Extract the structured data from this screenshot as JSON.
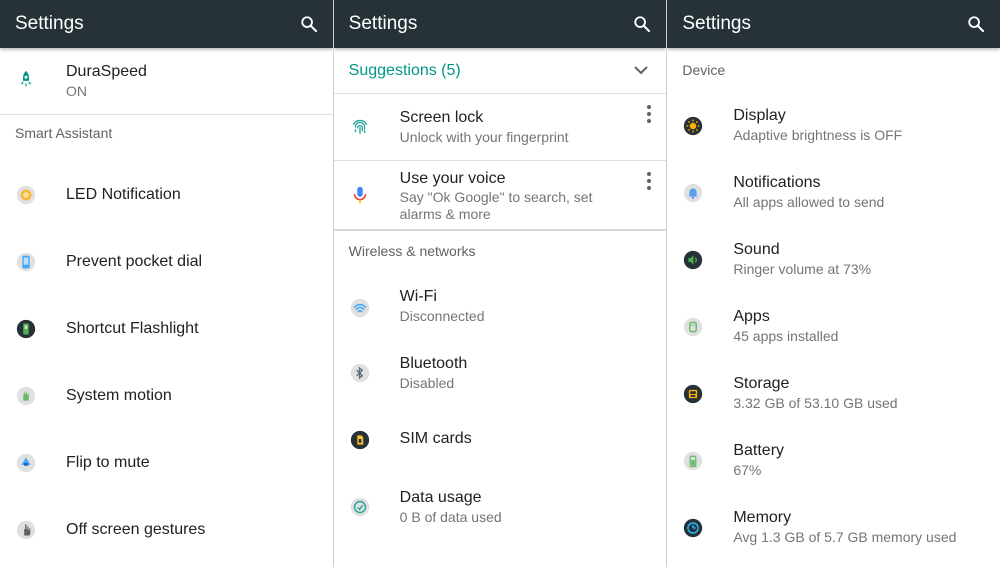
{
  "panels": [
    {
      "title": "Settings",
      "top": {
        "title": "DuraSpeed",
        "subtitle": "ON"
      },
      "section": "Smart Assistant",
      "items": [
        {
          "title": "LED Notification"
        },
        {
          "title": "Prevent pocket dial"
        },
        {
          "title": "Shortcut Flashlight"
        },
        {
          "title": "System motion"
        },
        {
          "title": "Flip to mute"
        },
        {
          "title": "Off screen gestures"
        }
      ]
    },
    {
      "title": "Settings",
      "suggestions_label": "Suggestions (5)",
      "suggestions": [
        {
          "title": "Screen lock",
          "subtitle": "Unlock with your fingerprint"
        },
        {
          "title": "Use your voice",
          "subtitle": "Say \"Ok Google\" to search, set alarms & more"
        }
      ],
      "section": "Wireless & networks",
      "items": [
        {
          "title": "Wi-Fi",
          "subtitle": "Disconnected"
        },
        {
          "title": "Bluetooth",
          "subtitle": "Disabled"
        },
        {
          "title": "SIM cards"
        },
        {
          "title": "Data usage",
          "subtitle": "0 B of data used"
        }
      ]
    },
    {
      "title": "Settings",
      "section": "Device",
      "items": [
        {
          "title": "Display",
          "subtitle": "Adaptive brightness is OFF"
        },
        {
          "title": "Notifications",
          "subtitle": "All apps allowed to send"
        },
        {
          "title": "Sound",
          "subtitle": "Ringer volume at 73%"
        },
        {
          "title": "Apps",
          "subtitle": "45 apps installed"
        },
        {
          "title": "Storage",
          "subtitle": "3.32 GB of 53.10 GB used"
        },
        {
          "title": "Battery",
          "subtitle": "67%"
        },
        {
          "title": "Memory",
          "subtitle": "Avg 1.3 GB of 5.7 GB memory used"
        }
      ]
    }
  ],
  "colors": {
    "appbar": "#263238",
    "accent": "#009688"
  }
}
